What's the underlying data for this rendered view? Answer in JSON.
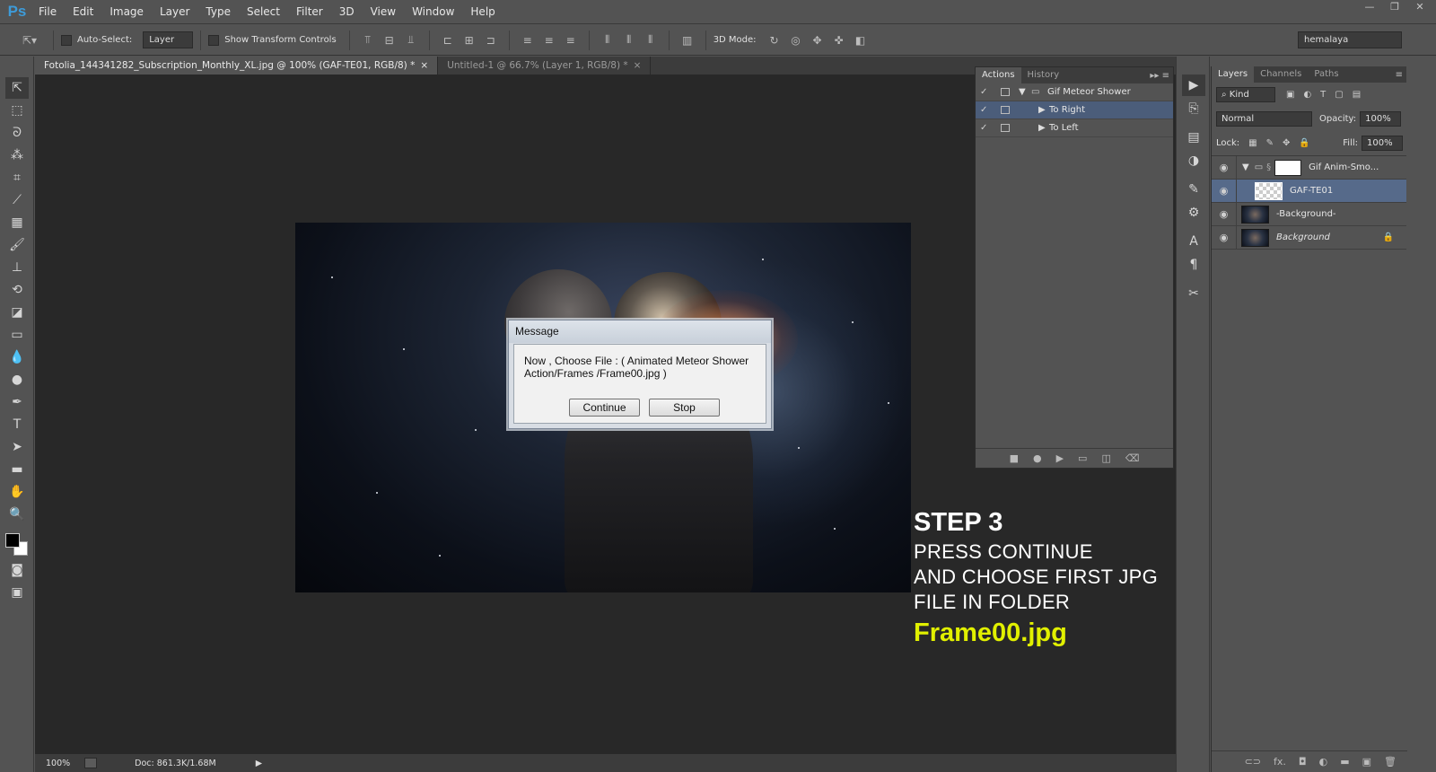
{
  "app": {
    "logo": "Ps"
  },
  "menu": [
    "File",
    "Edit",
    "Image",
    "Layer",
    "Type",
    "Select",
    "Filter",
    "3D",
    "View",
    "Window",
    "Help"
  ],
  "window_controls": [
    "—",
    "❐",
    "✕"
  ],
  "options": {
    "auto_select_label": "Auto-Select:",
    "auto_select_value": "Layer",
    "transform_label": "Show Transform Controls",
    "mode_3d_label": "3D Mode:",
    "workspace": "hemalaya"
  },
  "tabs": [
    {
      "label": "Fotolia_144341282_Subscription_Monthly_XL.jpg @ 100% (GAF-TE01, RGB/8) *",
      "close": "×"
    },
    {
      "label": "Untitled-1 @ 66.7% (Layer 1, RGB/8) *",
      "close": "×"
    }
  ],
  "status": {
    "zoom": "100%",
    "doc": "Doc: 861.3K/1.68M"
  },
  "dialog": {
    "title": "Message",
    "message": "Now , Choose File : ( Animated Meteor Shower Action/Frames /Frame00.jpg )",
    "continue": "Continue",
    "stop": "Stop"
  },
  "step": {
    "title": "STEP 3",
    "line1": "PRESS CONTINUE",
    "line2": "AND CHOOSE FIRST JPG",
    "line3": "FILE IN FOLDER",
    "file": "Frame00.jpg",
    "file_color": "#e1f000"
  },
  "actions_panel": {
    "tabs": [
      "Actions",
      "History"
    ],
    "rows": [
      {
        "label": "Gif Meteor Shower",
        "check": "✓"
      },
      {
        "label": "To Right",
        "check": "✓"
      },
      {
        "label": "To Left",
        "check": "✓"
      }
    ]
  },
  "layers_panel": {
    "tabs": [
      "Layers",
      "Channels",
      "Paths"
    ],
    "kind": "Kind",
    "blend_mode": "Normal",
    "opacity_label": "Opacity:",
    "opacity_value": "100%",
    "lock_label": "Lock:",
    "fill_label": "Fill:",
    "fill_value": "100%",
    "layers": [
      {
        "name": "Gif Anim-Smo..."
      },
      {
        "name": "GAF-TE01"
      },
      {
        "name": "-Background-"
      },
      {
        "name": "Background"
      }
    ],
    "footer": [
      "⊂⊃",
      "fx.",
      "◘",
      "◐",
      "▬",
      "▣",
      "🗑"
    ]
  },
  "colors": {
    "selection": "#4b5d7a",
    "layer_selection": "#566a8a",
    "accent": "#3d9bd9"
  }
}
